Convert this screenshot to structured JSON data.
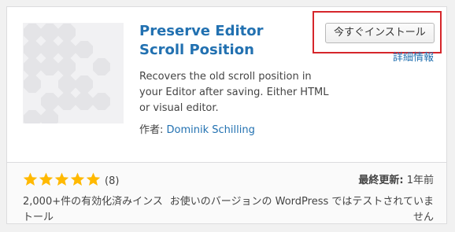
{
  "plugin": {
    "name": "Preserve Editor Scroll Position",
    "install_button": "今すぐインストール",
    "details_link": "詳細情報",
    "description": "Recovers the old scroll position in your Editor after saving. Either HTML or visual editor.",
    "author_label": "作者: ",
    "author_name": "Dominik Schilling",
    "rating": 5,
    "rating_count": "(8)",
    "installs": "2,000+件の有効化済みインストール",
    "last_updated_label": "最終更新:",
    "last_updated_value": " 1年前",
    "compatibility": "お使いのバージョンの WordPress ではテストされていません"
  },
  "colors": {
    "link": "#2271b1",
    "star": "#ffb900",
    "highlight_border": "#d6262b",
    "thumb_shape": "#e4e4e7"
  }
}
